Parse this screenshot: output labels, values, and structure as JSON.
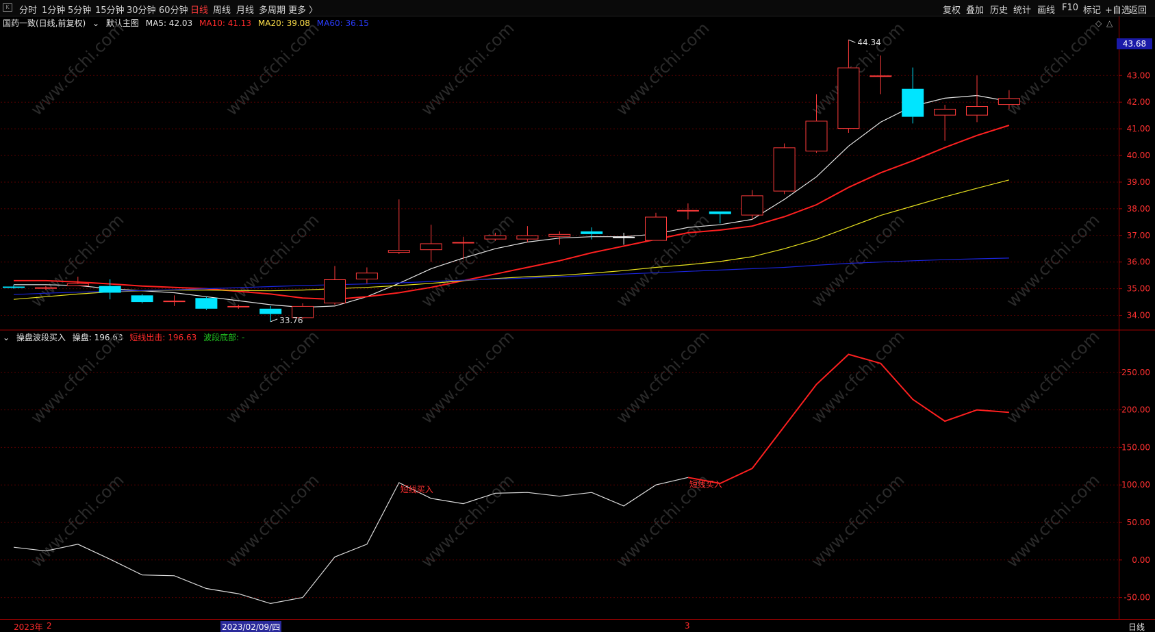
{
  "toolbar": {
    "left_items": [
      {
        "label": "分时",
        "active": false
      },
      {
        "label": "1分钟",
        "active": false
      },
      {
        "label": "5分钟",
        "active": false
      },
      {
        "label": "15分钟",
        "active": false
      },
      {
        "label": "30分钟",
        "active": false
      },
      {
        "label": "60分钟",
        "active": false
      },
      {
        "label": "日线",
        "active": true
      },
      {
        "label": "周线",
        "active": false
      },
      {
        "label": "月线",
        "active": false
      },
      {
        "label": "多周期",
        "active": false
      },
      {
        "label": "更多 〉",
        "active": false
      }
    ],
    "right_items": [
      "复权",
      "叠加",
      "历史",
      "统计",
      "画线",
      "F10",
      "标记",
      "+自选",
      "返回"
    ]
  },
  "main_chart": {
    "title": "国药一致(日线,前复权)",
    "template": "默认主图",
    "ma5_label": "MA5: 42.03",
    "ma10_label": "MA10: 41.13",
    "ma20_label": "MA20: 39.08",
    "ma60_label": "MA60: 36.15",
    "last_price_tag": "43.68",
    "high_annotation": "44.34",
    "low_annotation": "33.76",
    "y_ticks": [
      "43.00",
      "42.00",
      "41.00",
      "40.00",
      "39.00",
      "38.00",
      "37.00",
      "36.00",
      "35.00",
      "34.00"
    ],
    "colors": {
      "up": "#ff3b3b",
      "down": "#00e5ff",
      "ma5": "#e6e6e6",
      "ma10": "#ff2020",
      "ma20": "#e6e01e",
      "ma60": "#1a24d8"
    }
  },
  "indicator": {
    "name": "操盘波段买入",
    "value_label": "操盘: 196.63",
    "sell_label": "短线出击: 196.63",
    "bottom_label": "波段底部: -",
    "y_ticks": [
      "250.00",
      "200.00",
      "150.00",
      "100.00",
      "50.00",
      "0.00",
      "-50.00"
    ],
    "buy_signal_text": "短线买入"
  },
  "bottom_bar": {
    "year_label": "2023年",
    "month_2": "2",
    "selected_date": "2023/02/09/四",
    "month_3": "3",
    "period_label": "日线"
  },
  "watermark": "www.cfchi.com",
  "chart_data": [
    {
      "type": "candlestick",
      "title": "国药一致(日线,前复权)",
      "ylim": [
        33.5,
        44.6
      ],
      "candles": [
        {
          "o": 35.08,
          "c": 35.08,
          "h": 35.15,
          "l": 35.0,
          "dir": "down"
        },
        {
          "o": 35.0,
          "c": 35.05,
          "h": 35.1,
          "l": 34.95,
          "dir": "up"
        },
        {
          "o": 35.1,
          "c": 35.2,
          "h": 35.45,
          "l": 35.1,
          "dir": "up"
        },
        {
          "o": 35.1,
          "c": 34.85,
          "h": 35.35,
          "l": 34.6,
          "dir": "down"
        },
        {
          "o": 34.75,
          "c": 34.5,
          "h": 34.8,
          "l": 34.45,
          "dir": "down"
        },
        {
          "o": 34.5,
          "c": 34.55,
          "h": 34.75,
          "l": 34.35,
          "dir": "up"
        },
        {
          "o": 34.65,
          "c": 34.25,
          "h": 34.7,
          "l": 34.2,
          "dir": "down"
        },
        {
          "o": 34.3,
          "c": 34.35,
          "h": 34.4,
          "l": 34.25,
          "dir": "up"
        },
        {
          "o": 34.25,
          "c": 34.05,
          "h": 34.35,
          "l": 33.76,
          "dir": "down"
        },
        {
          "o": 33.9,
          "c": 34.35,
          "h": 34.45,
          "l": 33.85,
          "dir": "up"
        },
        {
          "o": 34.45,
          "c": 35.35,
          "h": 35.85,
          "l": 34.4,
          "dir": "up"
        },
        {
          "o": 35.35,
          "c": 35.6,
          "h": 35.8,
          "l": 35.2,
          "dir": "up"
        },
        {
          "o": 36.35,
          "c": 36.45,
          "h": 38.35,
          "l": 36.3,
          "dir": "up"
        },
        {
          "o": 36.45,
          "c": 36.7,
          "h": 37.4,
          "l": 36.0,
          "dir": "up"
        },
        {
          "o": 36.7,
          "c": 36.75,
          "h": 36.95,
          "l": 36.1,
          "dir": "up"
        },
        {
          "o": 36.85,
          "c": 37.0,
          "h": 37.1,
          "l": 36.8,
          "dir": "up"
        },
        {
          "o": 36.85,
          "c": 37.0,
          "h": 37.35,
          "l": 36.75,
          "dir": "up"
        },
        {
          "o": 36.95,
          "c": 37.05,
          "h": 37.15,
          "l": 36.65,
          "dir": "up"
        },
        {
          "o": 37.15,
          "c": 37.05,
          "h": 37.3,
          "l": 36.85,
          "dir": "down"
        },
        {
          "o": 36.95,
          "c": 36.9,
          "h": 37.1,
          "l": 36.65,
          "dir": "flat"
        },
        {
          "o": 36.8,
          "c": 37.7,
          "h": 37.85,
          "l": 36.8,
          "dir": "up"
        },
        {
          "o": 37.9,
          "c": 37.95,
          "h": 38.2,
          "l": 37.6,
          "dir": "up"
        },
        {
          "o": 37.9,
          "c": 37.8,
          "h": 37.9,
          "l": 37.45,
          "dir": "down"
        },
        {
          "o": 37.75,
          "c": 38.5,
          "h": 38.7,
          "l": 37.6,
          "dir": "up"
        },
        {
          "o": 38.65,
          "c": 40.3,
          "h": 40.45,
          "l": 38.55,
          "dir": "up"
        },
        {
          "o": 40.15,
          "c": 41.3,
          "h": 42.3,
          "l": 40.1,
          "dir": "up"
        },
        {
          "o": 41.0,
          "c": 43.3,
          "h": 44.34,
          "l": 40.85,
          "dir": "up"
        },
        {
          "o": 42.95,
          "c": 43.0,
          "h": 43.75,
          "l": 42.3,
          "dir": "up"
        },
        {
          "o": 42.5,
          "c": 41.45,
          "h": 43.3,
          "l": 41.2,
          "dir": "down"
        },
        {
          "o": 41.5,
          "c": 41.75,
          "h": 41.9,
          "l": 40.55,
          "dir": "up"
        },
        {
          "o": 41.5,
          "c": 41.85,
          "h": 43.0,
          "l": 41.25,
          "dir": "up"
        },
        {
          "o": 41.9,
          "c": 42.15,
          "h": 42.45,
          "l": 41.75,
          "dir": "up"
        }
      ],
      "series": [
        {
          "name": "MA5",
          "values": [
            35.15,
            35.15,
            35.12,
            35.0,
            34.92,
            34.85,
            34.7,
            34.55,
            34.4,
            34.3,
            34.35,
            34.7,
            35.2,
            35.75,
            36.15,
            36.5,
            36.75,
            36.9,
            36.95,
            36.95,
            37.05,
            37.3,
            37.4,
            37.6,
            38.35,
            39.2,
            40.35,
            41.25,
            41.85,
            42.15,
            42.25,
            42.03
          ]
        },
        {
          "name": "MA10",
          "values": [
            35.3,
            35.3,
            35.25,
            35.18,
            35.1,
            35.05,
            35.0,
            34.9,
            34.8,
            34.65,
            34.6,
            34.7,
            34.85,
            35.05,
            35.3,
            35.55,
            35.8,
            36.05,
            36.35,
            36.6,
            36.85,
            37.1,
            37.2,
            37.35,
            37.7,
            38.15,
            38.8,
            39.35,
            39.8,
            40.3,
            40.75,
            41.13
          ]
        },
        {
          "name": "MA20",
          "values": [
            34.6,
            34.7,
            34.8,
            34.88,
            34.92,
            34.95,
            34.95,
            34.93,
            34.92,
            34.95,
            35.0,
            35.05,
            35.12,
            35.2,
            35.3,
            35.38,
            35.45,
            35.5,
            35.58,
            35.68,
            35.8,
            35.9,
            36.02,
            36.2,
            36.5,
            36.85,
            37.3,
            37.75,
            38.1,
            38.45,
            38.77,
            39.08
          ]
        },
        {
          "name": "MA60",
          "values": [
            34.78,
            34.83,
            34.87,
            34.9,
            34.93,
            34.96,
            35.0,
            35.04,
            35.08,
            35.12,
            35.15,
            35.18,
            35.22,
            35.27,
            35.32,
            35.36,
            35.4,
            35.45,
            35.5,
            35.55,
            35.6,
            35.65,
            35.7,
            35.75,
            35.8,
            35.88,
            35.95,
            36.0,
            36.05,
            36.09,
            36.12,
            36.15
          ]
        }
      ]
    },
    {
      "type": "line",
      "title": "操盘波段买入",
      "ylim": [
        -75,
        290
      ],
      "series": [
        {
          "name": "操盘",
          "values": [
            17,
            12,
            21,
            1,
            -20,
            -21,
            -38,
            -45,
            -58,
            -50,
            4,
            21,
            103,
            82,
            75,
            89,
            90,
            85,
            90,
            72,
            100,
            110,
            102,
            122,
            178,
            234,
            274,
            262,
            214,
            185,
            200,
            196.63
          ]
        }
      ],
      "red_from_index": 21,
      "signals": [
        {
          "index": 12,
          "label": "短线买入"
        },
        {
          "index": 21,
          "label": "短线买入"
        }
      ]
    }
  ]
}
